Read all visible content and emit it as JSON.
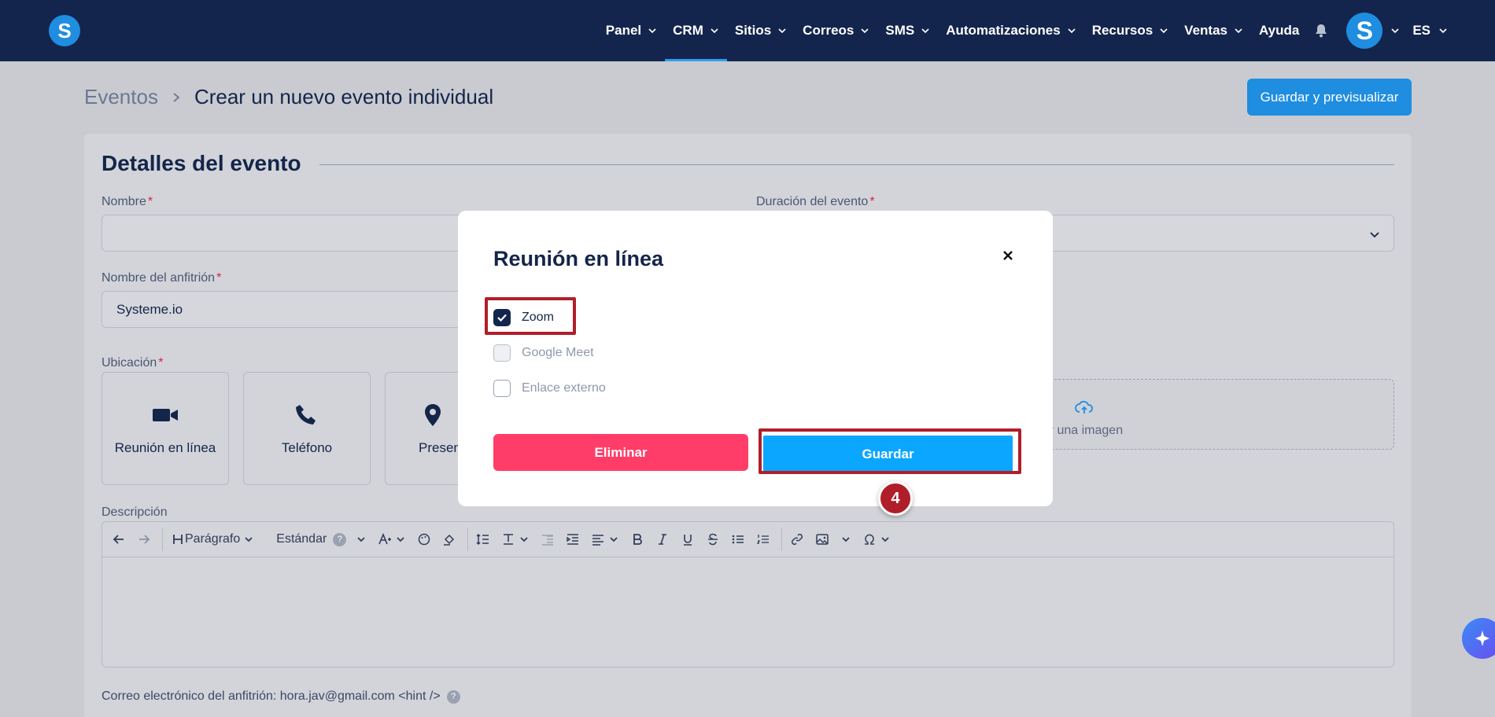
{
  "nav": {
    "items": [
      {
        "label": "Panel",
        "active": false
      },
      {
        "label": "CRM",
        "active": true
      },
      {
        "label": "Sitios",
        "active": false
      },
      {
        "label": "Correos",
        "active": false
      },
      {
        "label": "SMS",
        "active": false
      },
      {
        "label": "Automatizaciones",
        "active": false
      },
      {
        "label": "Recursos",
        "active": false
      },
      {
        "label": "Ventas",
        "active": false
      }
    ],
    "help_label": "Ayuda",
    "logo_letter": "S",
    "avatar_letter": "S",
    "language": "ES"
  },
  "header": {
    "breadcrumb_parent": "Eventos",
    "breadcrumb_current": "Crear un nuevo evento individual",
    "save_preview_label": "Guardar y previsualizar"
  },
  "form": {
    "section_title": "Detalles del evento",
    "name_label": "Nombre",
    "name_value": "",
    "duration_label": "Duración del evento",
    "host_label": "Nombre del anfitrión",
    "host_value": "Systeme.io",
    "location_label": "Ubicación",
    "locations": [
      {
        "label": "Reunión en línea",
        "icon": "video-camera-icon"
      },
      {
        "label": "Teléfono",
        "icon": "phone-icon"
      },
      {
        "label": "Presen",
        "icon": "map-pin-icon"
      }
    ],
    "upload_text": "onar una imagen",
    "description_label": "Descripción",
    "host_email": "Correo electrónico del anfitrión: hora.jav@gmail.com <hint />"
  },
  "editor": {
    "paragraph_label": "Parágrafo",
    "font_label": "Estándar",
    "hint_mark": "?"
  },
  "modal": {
    "title": "Reunión en línea",
    "options": [
      {
        "label": "Zoom",
        "checked": true,
        "disabled": false
      },
      {
        "label": "Google Meet",
        "checked": false,
        "disabled": true
      },
      {
        "label": "Enlace externo",
        "checked": false,
        "disabled": false
      }
    ],
    "delete_label": "Eliminar",
    "save_label": "Guardar",
    "step_number": "4"
  },
  "colors": {
    "nav_bg": "#14254d",
    "primary": "#1f8de0",
    "save_blue": "#0aa6ff",
    "delete_pink": "#ff3d68",
    "highlight_red": "#b01e2a"
  }
}
